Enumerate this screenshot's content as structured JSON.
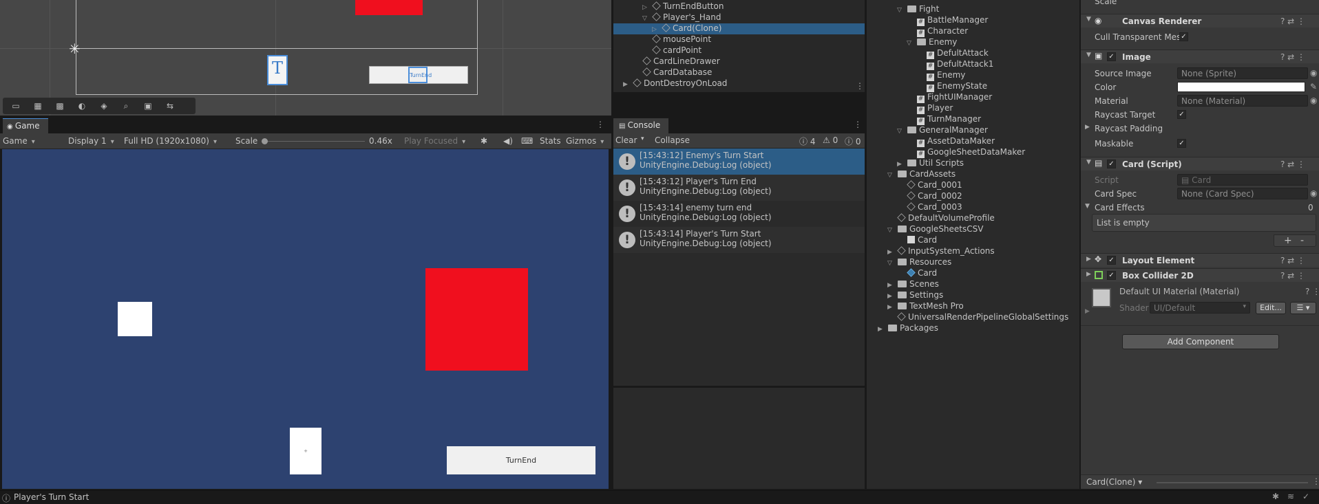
{
  "scene": {
    "tools": [
      "rect-tool-icon",
      "grid-tool-icon",
      "snap-tool-icon",
      "sphere-tool-icon",
      "layers-tool-icon",
      "search-tool-icon",
      "camera-tool-icon",
      "swap-tool-icon"
    ],
    "card_letter": "T",
    "turnend_label": "TurnEnd"
  },
  "game": {
    "tab_label": "Game",
    "mode": "Game",
    "display": "Display 1",
    "resolution": "Full HD (1920x1080)",
    "scale_label": "Scale",
    "scale_value": "0.46x",
    "play_focused": "Play Focused",
    "stats": "Stats",
    "gizmos": "Gizmos",
    "card_dot": "+",
    "turnend_button": "TurnEnd",
    "colors": {
      "background": "#2d4270",
      "enemy": "#f00f1e",
      "card": "#ffffff",
      "button": "#f0f0f0"
    }
  },
  "hierarchy": {
    "rows": [
      {
        "label": "TurnEndButton",
        "indent": 3,
        "arrow": "▷"
      },
      {
        "label": "Player's_Hand",
        "indent": 3,
        "arrow": "▽"
      },
      {
        "label": "Card(Clone)",
        "indent": 4,
        "arrow": "▷",
        "selected": true
      },
      {
        "label": "mousePoint",
        "indent": 3,
        "arrow": ""
      },
      {
        "label": "cardPoint",
        "indent": 3,
        "arrow": ""
      },
      {
        "label": "CardLineDrawer",
        "indent": 2,
        "arrow": ""
      },
      {
        "label": "CardDatabase",
        "indent": 2,
        "arrow": ""
      },
      {
        "label": "DontDestroyOnLoad",
        "indent": 1,
        "arrow": "▶"
      }
    ]
  },
  "console": {
    "tab_label": "Console",
    "clear": "Clear",
    "collapse": "Collapse",
    "count_logs": "4",
    "count_warnings": "0",
    "count_errors": "0",
    "entries": [
      {
        "time": "[15:43:12] Enemy's Turn Start",
        "source": "UnityEngine.Debug:Log (object)"
      },
      {
        "time": "[15:43:12] Player's Turn End",
        "source": "UnityEngine.Debug:Log (object)"
      },
      {
        "time": "[15:43:14] enemy turn end",
        "source": "UnityEngine.Debug:Log (object)"
      },
      {
        "time": "[15:43:14] Player's Turn Start",
        "source": "UnityEngine.Debug:Log (object)"
      }
    ]
  },
  "project": {
    "rows": [
      {
        "label": "Fight",
        "kind": "folder",
        "indent": 1,
        "arrow": "▽"
      },
      {
        "label": "BattleManager",
        "kind": "script",
        "indent": 2
      },
      {
        "label": "Character",
        "kind": "script",
        "indent": 2
      },
      {
        "label": "Enemy",
        "kind": "folder",
        "indent": 2,
        "arrow": "▽"
      },
      {
        "label": "DefultAttack",
        "kind": "script",
        "indent": 3
      },
      {
        "label": "DefultAttack1",
        "kind": "script",
        "indent": 3
      },
      {
        "label": "Enemy",
        "kind": "script",
        "indent": 3
      },
      {
        "label": "EnemyState",
        "kind": "script",
        "indent": 3
      },
      {
        "label": "FightUIManager",
        "kind": "script",
        "indent": 2
      },
      {
        "label": "Player",
        "kind": "script",
        "indent": 2
      },
      {
        "label": "TurnManager",
        "kind": "script",
        "indent": 2
      },
      {
        "label": "GeneralManager",
        "kind": "folder",
        "indent": 1,
        "arrow": "▽"
      },
      {
        "label": "AssetDataMaker",
        "kind": "script",
        "indent": 2
      },
      {
        "label": "GoogleSheetDataMaker",
        "kind": "script",
        "indent": 2
      },
      {
        "label": "Util Scripts",
        "kind": "folder",
        "indent": 1,
        "arrow": "▶"
      },
      {
        "label": "CardAssets",
        "kind": "folder",
        "indent": 0,
        "arrow": "▽"
      },
      {
        "label": "Card_0001",
        "kind": "asset",
        "indent": 1
      },
      {
        "label": "Card_0002",
        "kind": "asset",
        "indent": 1
      },
      {
        "label": "Card_0003",
        "kind": "asset",
        "indent": 1
      },
      {
        "label": "DefaultVolumeProfile",
        "kind": "asset",
        "indent": 0
      },
      {
        "label": "GoogleSheetsCSV",
        "kind": "folder",
        "indent": 0,
        "arrow": "▽"
      },
      {
        "label": "Card",
        "kind": "file",
        "indent": 1
      },
      {
        "label": "InputSystem_Actions",
        "kind": "asset",
        "indent": 0,
        "arrow": "▶"
      },
      {
        "label": "Resources",
        "kind": "folder",
        "indent": 0,
        "arrow": "▽"
      },
      {
        "label": "Card",
        "kind": "prefab",
        "indent": 1
      },
      {
        "label": "Scenes",
        "kind": "folder",
        "indent": 0,
        "arrow": "▶"
      },
      {
        "label": "Settings",
        "kind": "folder",
        "indent": 0,
        "arrow": "▶"
      },
      {
        "label": "TextMesh Pro",
        "kind": "folder",
        "indent": 0,
        "arrow": "▶"
      },
      {
        "label": "UniversalRenderPipelineGlobalSettings",
        "kind": "asset",
        "indent": 0
      },
      {
        "label": "Packages",
        "kind": "folder",
        "indent": -1,
        "arrow": "▶"
      }
    ]
  },
  "inspector": {
    "scale_label": "Scale",
    "canvas_renderer": "Canvas Renderer",
    "cull_transparent": "Cull Transparent Mes",
    "image": "Image",
    "source_image_label": "Source Image",
    "source_image_value": "None (Sprite)",
    "color_label": "Color",
    "material_label": "Material",
    "material_value": "None (Material)",
    "raycast_target": "Raycast Target",
    "raycast_padding": "Raycast Padding",
    "maskable": "Maskable",
    "card_script": "Card (Script)",
    "script_label": "Script",
    "script_value": "Card",
    "card_spec_label": "Card Spec",
    "card_spec_value": "None (Card Spec)",
    "card_effects_label": "Card Effects",
    "card_effects_count": "0",
    "list_empty": "List is empty",
    "plus": "+",
    "minus": "-",
    "layout_element": "Layout Element",
    "box_collider": "Box Collider 2D",
    "default_material": "Default UI Material (Material)",
    "shader_label": "Shader",
    "shader_value": "UI/Default",
    "edit": "Edit...",
    "add_component": "Add Component",
    "footer_object": "Card(Clone)"
  },
  "status": {
    "message": "Player's Turn Start"
  }
}
